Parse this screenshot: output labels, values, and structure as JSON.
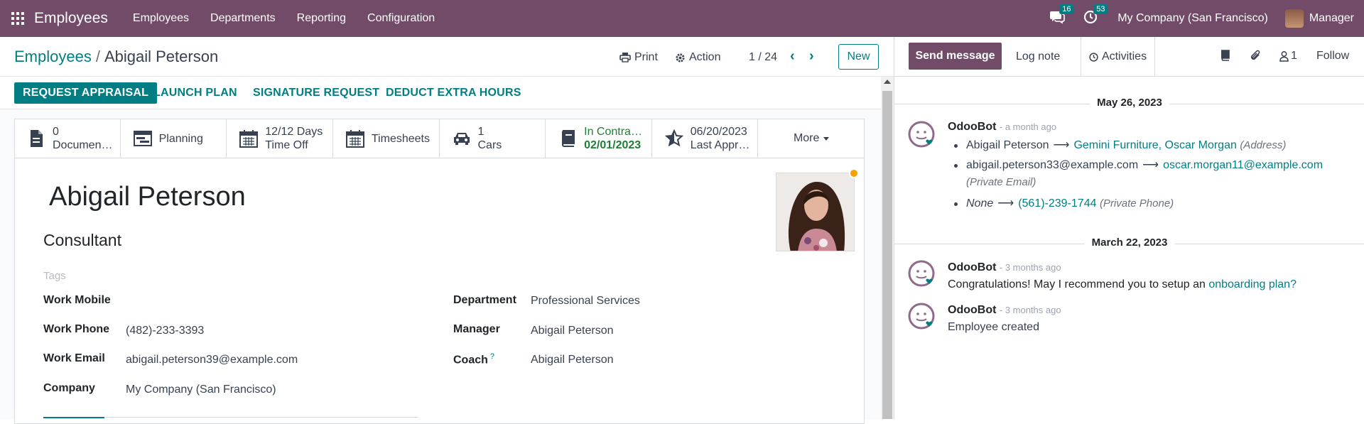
{
  "topbar": {
    "app_name": "Employees",
    "menu": [
      "Employees",
      "Departments",
      "Reporting",
      "Configuration"
    ],
    "messages_count": "16",
    "activities_count": "53",
    "company": "My Company (San Francisco)",
    "user": "Manager"
  },
  "control": {
    "breadcrumb_parent": "Employees",
    "breadcrumb_sep": "/",
    "breadcrumb_current": "Abigail Peterson",
    "print_label": "Print",
    "action_label": "Action",
    "pager": "1 / 24",
    "new_label": "New"
  },
  "statusbar": {
    "request_appraisal": "REQUEST APPRAISAL",
    "launch_plan": "LAUNCH PLAN",
    "signature_request": "SIGNATURE REQUEST",
    "deduct_extra_hours": "DEDUCT EXTRA HOURS"
  },
  "smart_buttons": {
    "documents_value": "0",
    "documents_label": "Documen…",
    "planning_label": "Planning",
    "timeoff_value": "12/12 Days",
    "timeoff_label": "Time Off",
    "timesheets_label": "Timesheets",
    "cars_value": "1",
    "cars_label": "Cars",
    "contract_value": "In Contra…",
    "contract_date": "02/01/2023",
    "appraisal_value": "06/20/2023",
    "appraisal_label": "Last Appr…",
    "more_label": "More"
  },
  "employee": {
    "name": "Abigail Peterson",
    "job_title": "Consultant",
    "tags_placeholder": "Tags"
  },
  "fields": {
    "work_mobile_label": "Work Mobile",
    "work_mobile_value": "",
    "work_phone_label": "Work Phone",
    "work_phone_value": "(482)-233-3393",
    "work_email_label": "Work Email",
    "work_email_value": "abigail.peterson39@example.com",
    "company_label": "Company",
    "company_value": "My Company (San Francisco)",
    "department_label": "Department",
    "department_value": "Professional Services",
    "manager_label": "Manager",
    "manager_value": "Abigail Peterson",
    "coach_label": "Coach",
    "coach_help": "?",
    "coach_value": "Abigail Peterson"
  },
  "chatter": {
    "send_message": "Send message",
    "log_note": "Log note",
    "activities": "Activities",
    "followers_count": "1",
    "follow": "Follow",
    "groups": [
      {
        "date": "May 26, 2023",
        "author": "OdooBot",
        "when": "- a month ago",
        "tracking": [
          {
            "old": "Abigail Peterson",
            "new": "Gemini Furniture, Oscar Morgan",
            "field": "(Address)"
          },
          {
            "old": "abigail.peterson33@example.com",
            "new": "oscar.morgan11@example.com",
            "field": "(Private Email)"
          },
          {
            "old": "None",
            "new": "(561)-239-1744",
            "field": "(Private Phone)"
          }
        ]
      },
      {
        "date": "March 22, 2023",
        "messages": [
          {
            "author": "OdooBot",
            "when": "- 3 months ago",
            "text": "Congratulations! May I recommend you to setup an ",
            "link": "onboarding plan?"
          },
          {
            "author": "OdooBot",
            "when": "- 3 months ago",
            "text": "Employee created"
          }
        ]
      }
    ]
  },
  "colors": {
    "brand": "#714b67",
    "accent": "#017e84",
    "status_dot": "#f3a200"
  }
}
